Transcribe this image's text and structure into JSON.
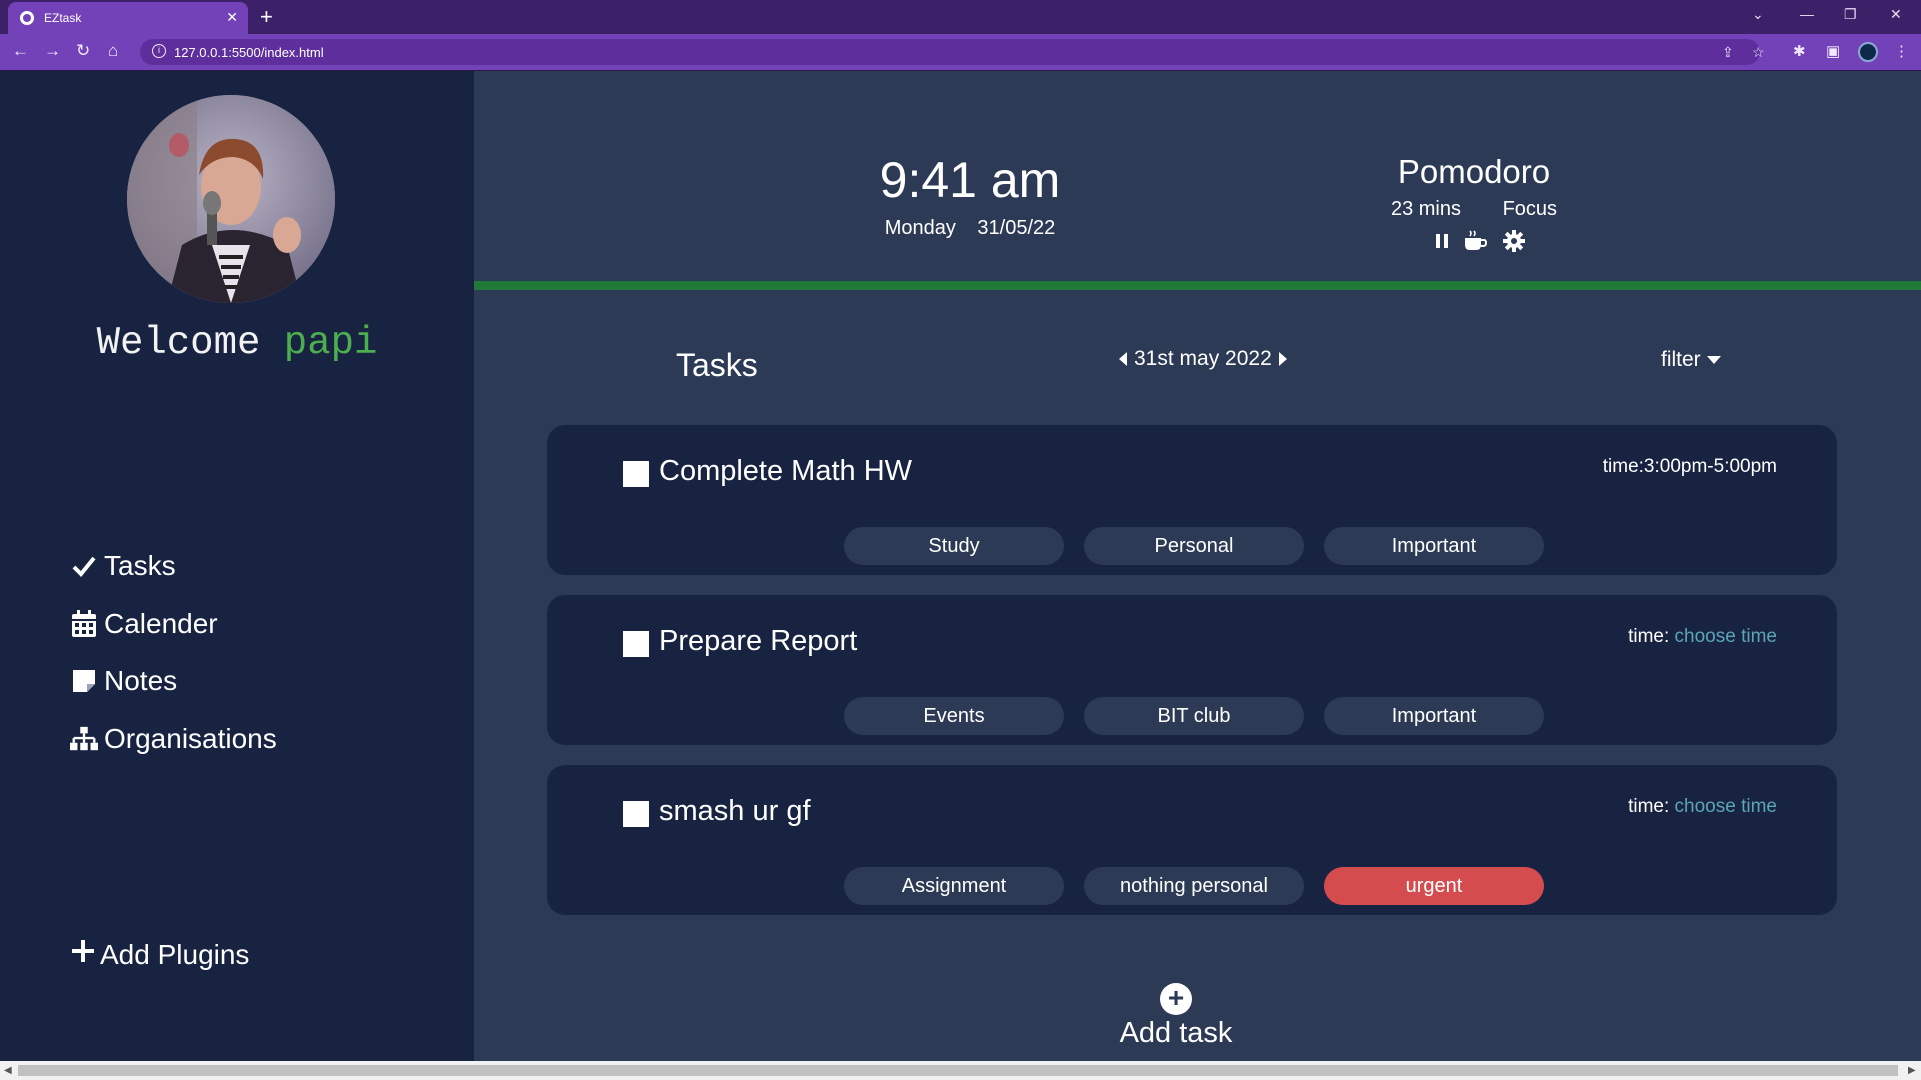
{
  "browser": {
    "tab_title": "EZtask",
    "url": "127.0.0.1:5500/index.html"
  },
  "sidebar": {
    "welcome_text": "Welcome",
    "user_name": "papi",
    "nav": [
      {
        "label": "Tasks",
        "icon": "check-icon"
      },
      {
        "label": "Calender",
        "icon": "calendar-icon"
      },
      {
        "label": "Notes",
        "icon": "note-icon"
      },
      {
        "label": "Organisations",
        "icon": "sitemap-icon"
      }
    ],
    "add_plugins": "Add Plugins"
  },
  "header": {
    "time": "9:41 am",
    "day": "Monday",
    "date": "31/05/22",
    "pomodoro": {
      "title": "Pomodoro",
      "duration": "23 mins",
      "mode": "Focus",
      "progress": 1.0,
      "progress_color": "#1f7a3a"
    }
  },
  "tasks": {
    "title": "Tasks",
    "current_date": "31st may 2022",
    "filter_label": "filter",
    "items": [
      {
        "name": "Complete Math HW",
        "time_label": "time:3:00pm-5:00pm",
        "time_link": "",
        "tags": [
          "Study",
          "Personal",
          "Important"
        ]
      },
      {
        "name": "Prepare Report",
        "time_label": "time: ",
        "time_link": "choose time",
        "tags": [
          "Events",
          "BIT club",
          "Important"
        ]
      },
      {
        "name": "smash ur gf",
        "time_label": "time: ",
        "time_link": "choose time",
        "tags": [
          "Assignment",
          "nothing personal",
          "urgent"
        ]
      }
    ],
    "add_task": "Add task"
  },
  "colors": {
    "sidebar_bg": "#182341",
    "main_bg": "#2c3a56",
    "accent_green": "#4cae4f",
    "urgent_red": "#d44c4e",
    "link_teal": "#5aa6b6"
  }
}
